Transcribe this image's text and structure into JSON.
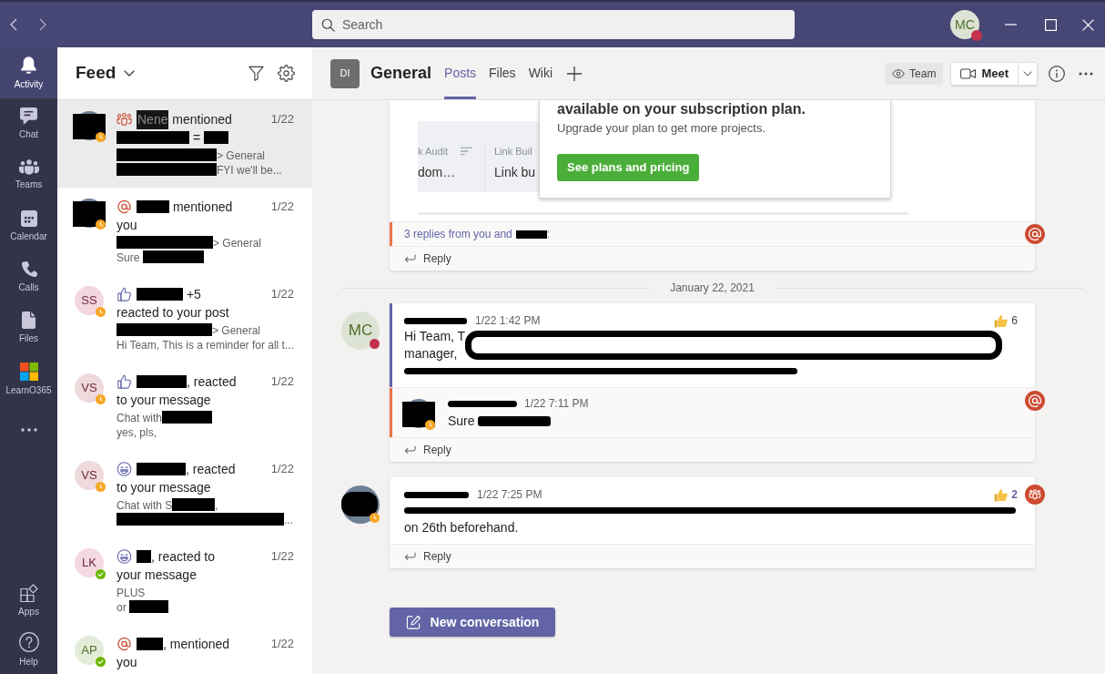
{
  "title_bar": {
    "search": {
      "placeholder": "Search"
    },
    "profile": {
      "kind": "initials",
      "initials": "MC",
      "color": "#dce3d4",
      "presence": {
        "kind": "busy"
      }
    }
  },
  "app_bar": {
    "items": [
      {
        "kind": "activity",
        "label": "Activity",
        "selected": true
      },
      {
        "kind": "chat",
        "label": "Chat",
        "selected": false
      },
      {
        "kind": "teams",
        "label": "Teams",
        "selected": false
      },
      {
        "kind": "calendar",
        "label": "Calendar",
        "selected": false
      },
      {
        "kind": "calls",
        "label": "Calls",
        "selected": false
      },
      {
        "kind": "files",
        "label": "Files",
        "selected": false
      },
      {
        "kind": "learn",
        "label": "LearnO365",
        "selected": false
      },
      {
        "kind": "more",
        "selected": false
      }
    ],
    "bottom_items": [
      {
        "kind": "apps",
        "label": "Apps",
        "selected": false
      },
      {
        "kind": "help",
        "label": "Help",
        "selected": false
      }
    ]
  },
  "feed": {
    "title": "Feed",
    "items": [
      {
        "selected": true,
        "kind": "team",
        "avatar": {
          "kind": "photo",
          "redacted": true,
          "presence": {
            "kind": "away"
          }
        },
        "date": "1/22",
        "summary": [
          [
            {
              "kind": "masked",
              "text": "Nene"
            },
            {
              "kind": "text",
              "text": " mentioned"
            }
          ],
          [
            {
              "kind": "redaction"
            },
            {
              "kind": "text",
              "text": " = "
            },
            {
              "kind": "redaction"
            }
          ]
        ],
        "context": [
          {
            "kind": "redaction"
          },
          {
            "kind": "text",
            "text": "> General"
          }
        ],
        "preview": [
          {
            "kind": "redaction"
          },
          {
            "kind": "text",
            "text": "FYI we'll be..."
          }
        ]
      },
      {
        "selected": false,
        "kind": "mention",
        "avatar": {
          "kind": "photo",
          "redacted": true,
          "presence": {
            "kind": "away"
          }
        },
        "date": "1/22",
        "summary": [
          [
            {
              "kind": "redaction"
            },
            {
              "kind": "text",
              "text": " mentioned"
            }
          ],
          [
            {
              "kind": "text",
              "text": "you"
            }
          ]
        ],
        "context": [
          {
            "kind": "redaction"
          },
          {
            "kind": "text",
            "text": "> General"
          }
        ],
        "preview": [
          {
            "kind": "text",
            "text": "Sure "
          },
          {
            "kind": "redaction"
          }
        ]
      },
      {
        "selected": false,
        "kind": "like",
        "avatar": {
          "kind": "initials",
          "initials": "SS",
          "color": "#f3d6de",
          "presence": {
            "kind": "away"
          }
        },
        "date": "1/22",
        "summary": [
          [
            {
              "kind": "redaction"
            },
            {
              "kind": "text",
              "text": " +5"
            }
          ],
          [
            {
              "kind": "text",
              "text": "reacted to your post"
            }
          ]
        ],
        "context": [
          {
            "kind": "redaction"
          },
          {
            "kind": "text",
            "text": "> General"
          }
        ],
        "preview": [
          {
            "kind": "text",
            "text": "Hi Team, This is a reminder for all t..."
          }
        ]
      },
      {
        "selected": false,
        "kind": "like",
        "avatar": {
          "kind": "initials",
          "initials": "VS",
          "color": "#eed9dc",
          "presence": {
            "kind": "away"
          }
        },
        "date": "1/22",
        "summary": [
          [
            {
              "kind": "redaction"
            },
            {
              "kind": "text",
              "text": ", reacted"
            }
          ],
          [
            {
              "kind": "text",
              "text": "to your message"
            }
          ]
        ],
        "context": [
          {
            "kind": "text",
            "text": "Chat with"
          },
          {
            "kind": "redaction"
          }
        ],
        "preview": [
          {
            "kind": "text",
            "text": "yes, pls,"
          }
        ]
      },
      {
        "selected": false,
        "kind": "laugh",
        "avatar": {
          "kind": "initials",
          "initials": "VS",
          "color": "#eed9dc",
          "presence": {
            "kind": "away"
          }
        },
        "date": "1/22",
        "summary": [
          [
            {
              "kind": "redaction"
            },
            {
              "kind": "text",
              "text": ", reacted"
            }
          ],
          [
            {
              "kind": "text",
              "text": "to your message"
            }
          ]
        ],
        "context": [
          {
            "kind": "text",
            "text": "Chat with S"
          },
          {
            "kind": "redaction"
          },
          {
            "kind": "text",
            "text": ","
          }
        ],
        "preview": [
          {
            "kind": "redaction"
          },
          {
            "kind": "text",
            "text": "..."
          }
        ]
      },
      {
        "selected": false,
        "kind": "laugh",
        "avatar": {
          "kind": "initials",
          "initials": "LK",
          "color": "#f4d9e1",
          "presence": {
            "kind": "available"
          }
        },
        "date": "1/22",
        "summary": [
          [
            {
              "kind": "redaction"
            },
            {
              "kind": "text",
              "text": ", reacted to"
            }
          ],
          [
            {
              "kind": "text",
              "text": "your message"
            }
          ]
        ],
        "context": [
          {
            "kind": "text",
            "text": "PLUS"
          }
        ],
        "preview": [
          {
            "kind": "text",
            "text": "or "
          },
          {
            "kind": "redaction"
          }
        ]
      },
      {
        "selected": false,
        "kind": "mention",
        "avatar": {
          "kind": "initials",
          "initials": "AP",
          "color": "#e3ebd9",
          "presence": {
            "kind": "available"
          }
        },
        "date": "1/22",
        "summary": [
          [
            {
              "kind": "redaction"
            },
            {
              "kind": "text",
              "text": ", mentioned"
            }
          ],
          [
            {
              "kind": "text",
              "text": "you"
            }
          ]
        ]
      }
    ]
  },
  "channel": {
    "initials": "DI",
    "name": "General",
    "tabs": [
      {
        "label": "Posts",
        "selected": true
      },
      {
        "label": "Files",
        "selected": false
      },
      {
        "label": "Wiki",
        "selected": false
      }
    ],
    "team_button": "Team",
    "meet_button": "Meet"
  },
  "posts": [
    {
      "kind": "partial",
      "attachment": {
        "heading": "available on your subscription plan.",
        "text": "Upgrade your plan to get more projects.",
        "button": "See plans and pricing",
        "columns": [
          {
            "header": "k Audit",
            "value": "dom…"
          },
          {
            "header": "Link Buil",
            "value": "Link bu"
          }
        ]
      },
      "thread": {
        "accent": {
          "kind": "mention"
        },
        "badge": {
          "kind": "mention"
        },
        "summary": [
          {
            "kind": "text",
            "text": "3 replies from you and"
          },
          {
            "kind": "redaction"
          },
          {
            "kind": "text",
            "text": ":"
          }
        ]
      },
      "reply_label": "Reply"
    },
    {
      "kind": "divider",
      "text": "January 22, 2021"
    },
    {
      "kind": "message",
      "avatar": {
        "kind": "initials",
        "initials": "MC",
        "color": "#dce3d4",
        "presence": {
          "kind": "busy"
        }
      },
      "accent": {
        "kind": "own"
      },
      "name": [
        {
          "kind": "redaction"
        }
      ],
      "time": "1/22 1:42 PM",
      "reaction": {
        "count": "6",
        "mine": false
      },
      "body": [
        [
          {
            "kind": "text",
            "text": "Hi Team, T"
          },
          {
            "kind": "cover"
          }
        ],
        [
          {
            "kind": "text",
            "text": "manager,"
          }
        ],
        [
          {
            "kind": "strike"
          }
        ]
      ],
      "replies": [
        {
          "avatar": {
            "kind": "photo",
            "redacted": true,
            "presence": {
              "kind": "away"
            }
          },
          "accent": {
            "kind": "mention"
          },
          "badge": {
            "kind": "mention"
          },
          "name": [
            {
              "kind": "strike"
            }
          ],
          "time": "1/22 7:11 PM",
          "body": [
            [
              {
                "kind": "text",
                "text": "Sure "
              },
              {
                "kind": "redaction"
              }
            ]
          ]
        }
      ],
      "reply_label": "Reply"
    },
    {
      "kind": "message",
      "avatar": {
        "kind": "photo",
        "redacted": true,
        "presence": {
          "kind": "away"
        }
      },
      "badge": {
        "kind": "team"
      },
      "name": [
        {
          "kind": "redaction"
        }
      ],
      "time": "1/22 7:25 PM",
      "reaction": {
        "count": "2",
        "mine": true
      },
      "body": [
        [
          {
            "kind": "strike"
          }
        ],
        [
          {
            "kind": "text",
            "text": "on 26th beforehand."
          }
        ]
      ],
      "reply_label": "Reply"
    }
  ],
  "new_conversation": {
    "label": "New conversation"
  }
}
